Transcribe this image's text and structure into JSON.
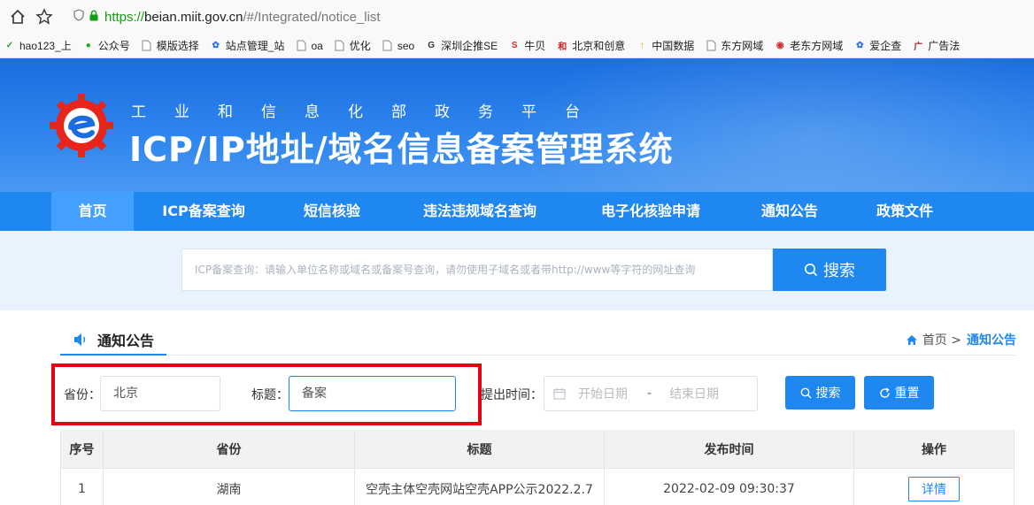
{
  "browser": {
    "url_proto": "https://",
    "url_host": "beian.miit.gov.cn",
    "url_path": "/#/Integrated/notice_list",
    "bookmarks": [
      {
        "label": "hao123_上",
        "icon": "hao-icon",
        "color": "#2d9c2d"
      },
      {
        "label": "公众号",
        "icon": "wechat-icon",
        "color": "#1aad19"
      },
      {
        "label": "模版选择",
        "icon": "page-icon",
        "color": "#888888"
      },
      {
        "label": "站点管理_站",
        "icon": "paw-icon",
        "color": "#2f6fe0"
      },
      {
        "label": "oa",
        "icon": "page-icon",
        "color": "#888888"
      },
      {
        "label": "优化",
        "icon": "page-icon",
        "color": "#888888"
      },
      {
        "label": "seo",
        "icon": "page-icon",
        "color": "#888888"
      },
      {
        "label": "深圳企推SE",
        "icon": "gt-icon",
        "color": "#333333"
      },
      {
        "label": "牛贝",
        "icon": "niubei-icon",
        "color": "#d12a2a"
      },
      {
        "label": "北京和创意",
        "icon": "he-icon",
        "color": "#c81e1e"
      },
      {
        "label": "中国数据",
        "icon": "fire-icon",
        "color": "#f08c00"
      },
      {
        "label": "东方网域",
        "icon": "page-icon",
        "color": "#888888"
      },
      {
        "label": "老东方网域",
        "icon": "circle-icon",
        "color": "#d12a2a"
      },
      {
        "label": "爱企查",
        "icon": "paw-icon",
        "color": "#2f6fe0"
      },
      {
        "label": "广告法",
        "icon": "ad-icon",
        "color": "#b01c1c"
      }
    ]
  },
  "header": {
    "subtitle": "工业和信息化部政务平台",
    "title": "ICP/IP地址/域名信息备案管理系统"
  },
  "nav": {
    "items": [
      "首页",
      "ICP备案查询",
      "短信核验",
      "违法违规域名查询",
      "电子化核验申请",
      "通知公告",
      "政策文件"
    ],
    "active_index": 0
  },
  "search": {
    "placeholder": "ICP备案查询：请输入单位名称或域名或备案号查询，请勿使用子域名或者带http://www等字符的网址查询",
    "button_label": "搜索"
  },
  "section": {
    "tab_label": "通知公告",
    "breadcrumb_home": "首页 >",
    "breadcrumb_current": "通知公告"
  },
  "filters": {
    "province_label": "省份：",
    "province_value": "北京",
    "title_label": "标题：",
    "title_value": "备案",
    "date_label": "提出时间：",
    "date_start_placeholder": "开始日期",
    "date_separator": "-",
    "date_end_placeholder": "结束日期",
    "search_label": "搜索",
    "reset_label": "重置"
  },
  "table": {
    "headers": [
      "序号",
      "省份",
      "标题",
      "发布时间",
      "操作"
    ],
    "rows": [
      {
        "index": "1",
        "province": "湖南",
        "title": "空壳主体空壳网站空壳APP公示2022.2.7",
        "date": "2022-02-09 09:30:37",
        "action": "详情"
      }
    ]
  },
  "colors": {
    "primary": "#1e87f0",
    "highlight_border": "#e60012",
    "url_secure": "#12a012"
  }
}
